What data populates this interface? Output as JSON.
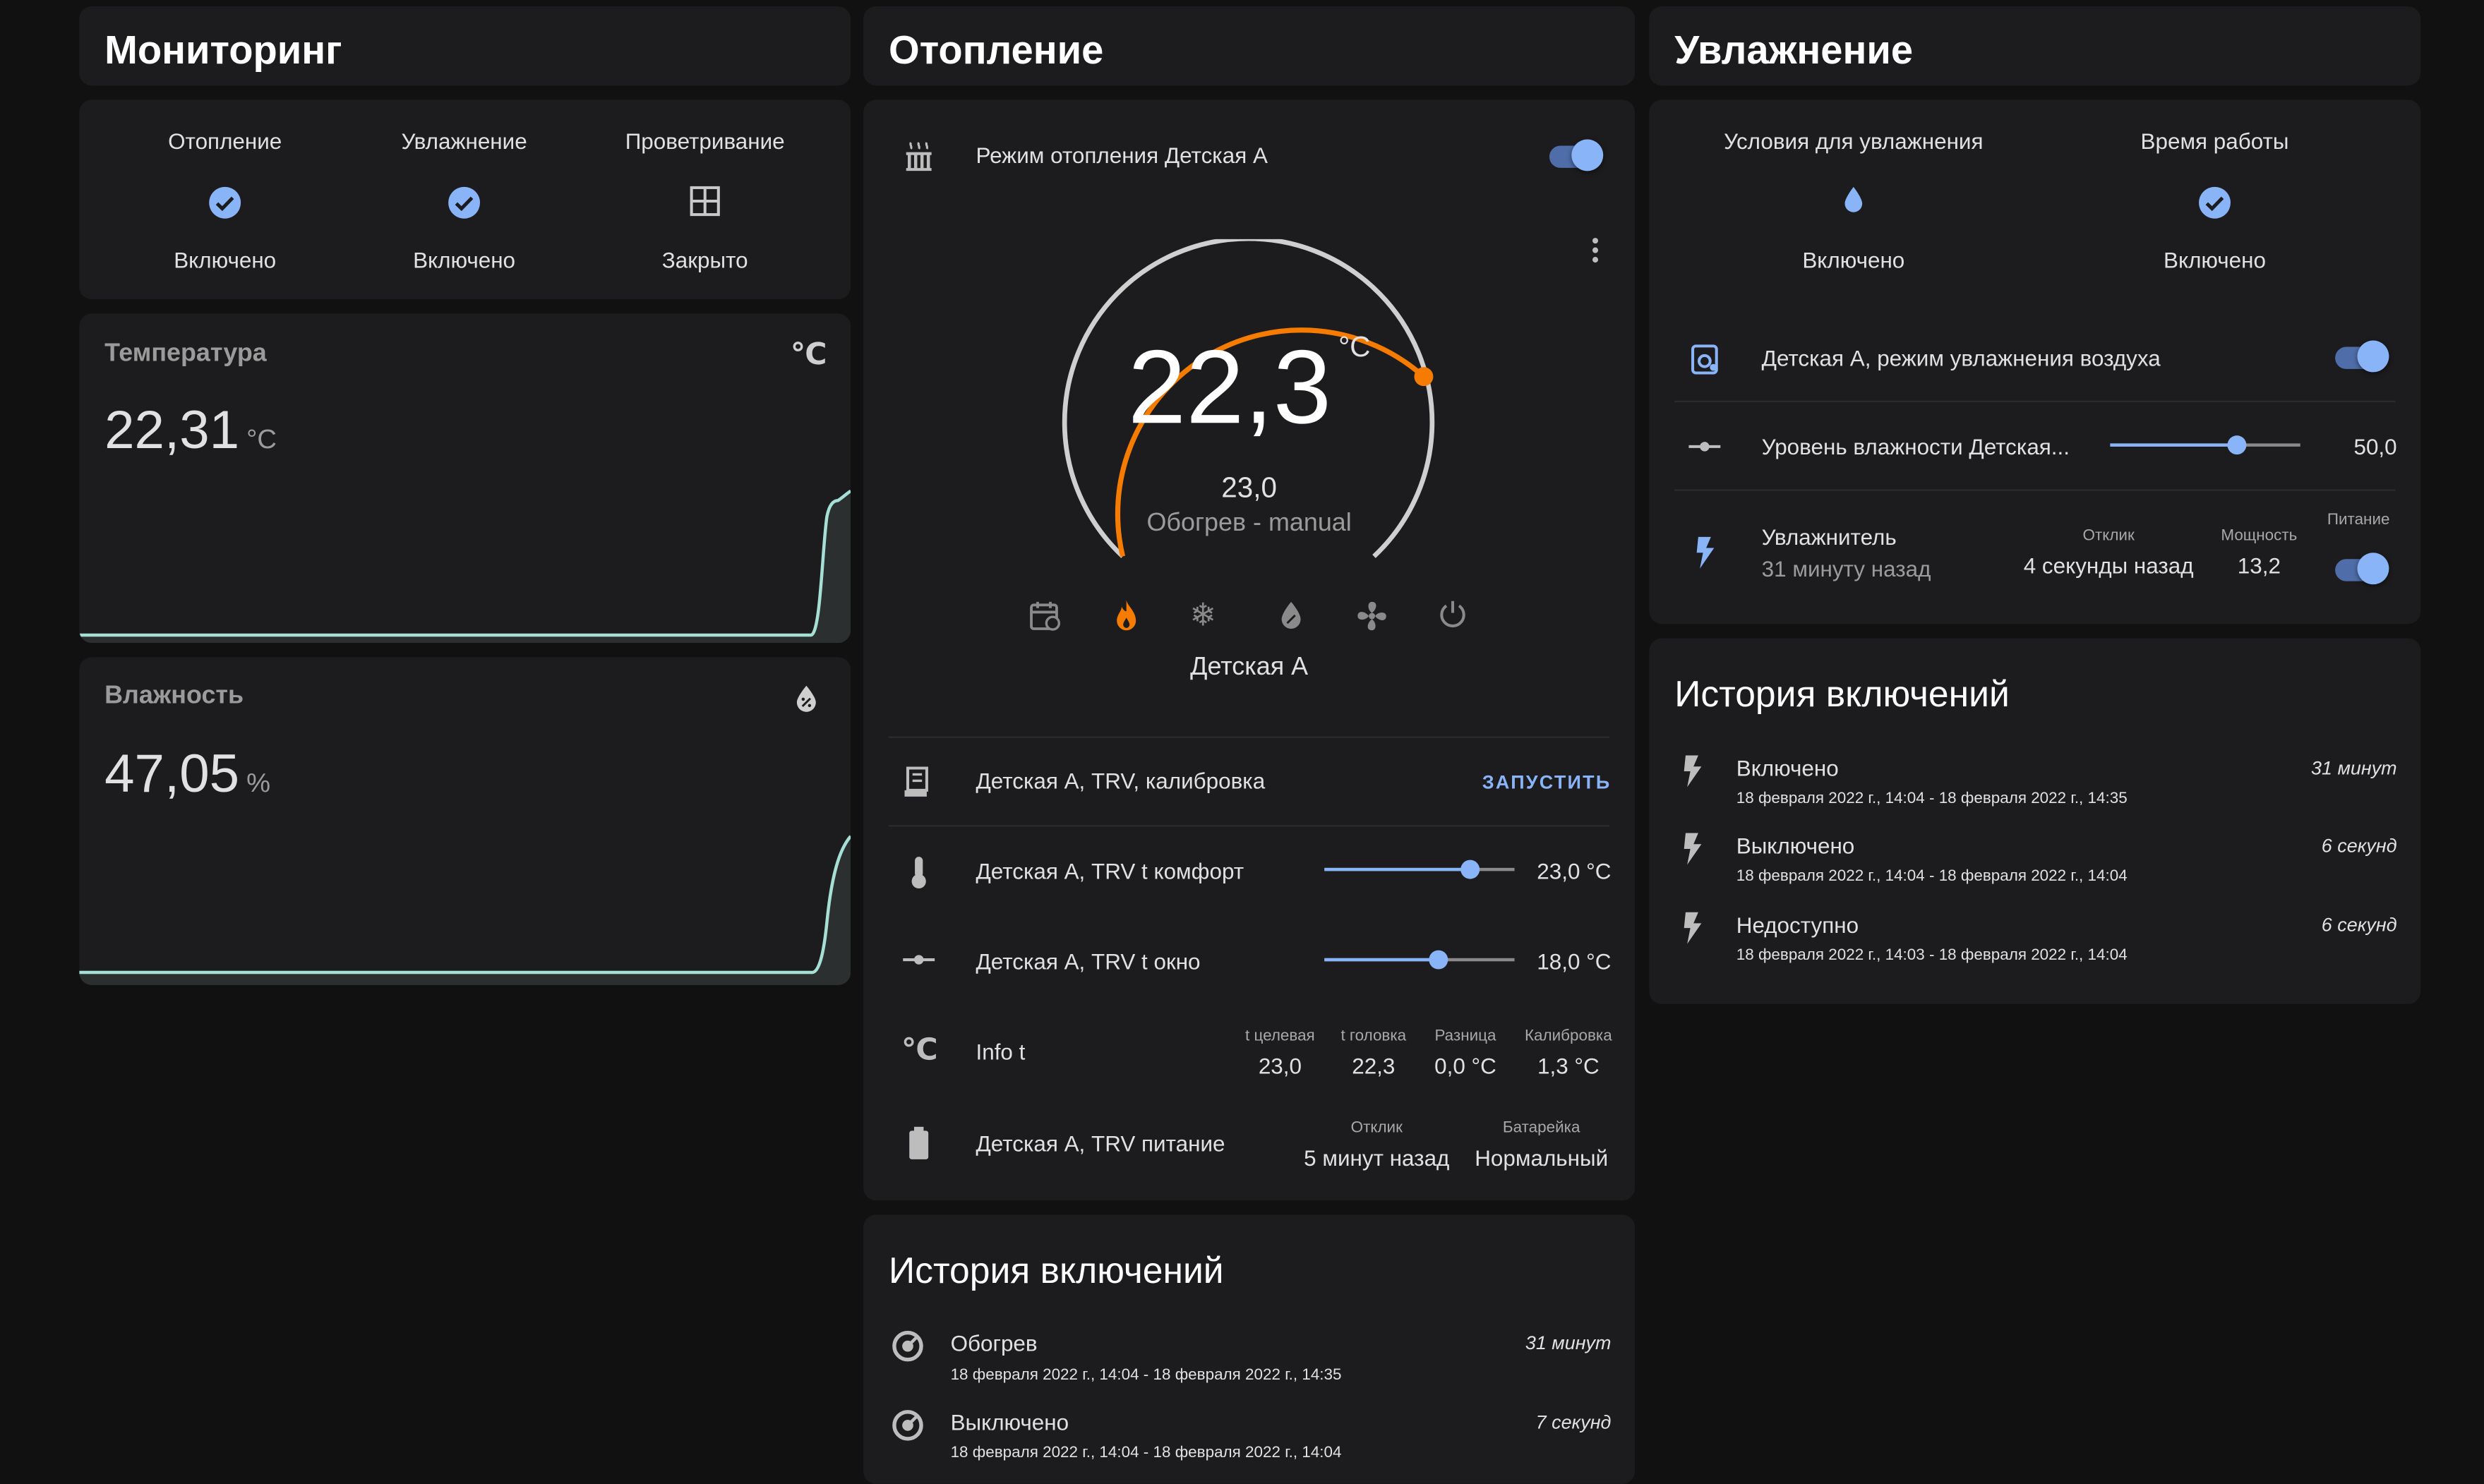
{
  "colors": {
    "background": "#111111",
    "card": "#1c1c1e",
    "accent": "#8ab4f8",
    "heat": "#f57c00"
  },
  "monitoring": {
    "title": "Мониторинг",
    "status": [
      {
        "label": "Отопление",
        "value": "Включено",
        "icon": "check-circle-icon"
      },
      {
        "label": "Увлажнение",
        "value": "Включено",
        "icon": "check-circle-icon"
      },
      {
        "label": "Проветривание",
        "value": "Закрыто",
        "icon": "window-icon"
      }
    ],
    "temperature": {
      "title": "Температура",
      "value": "22,31",
      "unit": "°C",
      "icon": "thermometer-celsius-icon"
    },
    "humidity": {
      "title": "Влажность",
      "value": "47,05",
      "unit": "%",
      "icon": "water-percent-icon"
    }
  },
  "heating": {
    "title": "Отопление",
    "mode_label": "Режим отопления Детская А",
    "mode_on": true,
    "thermostat": {
      "current": "22,3",
      "unit": "°C",
      "target": "23,0",
      "action": "Обогрев - manual",
      "name": "Детская А",
      "modes": [
        "schedule",
        "heat",
        "cool",
        "dry",
        "fan",
        "off"
      ],
      "active_mode": "heat"
    },
    "rows": {
      "calibration": {
        "label": "Детская А, TRV, калибровка",
        "button": "ЗАПУСТИТЬ"
      },
      "comfort": {
        "label": "Детская А, TRV t комфорт",
        "value": "23,0 °C",
        "level": 0.77
      },
      "window": {
        "label": "Детская А, TRV t окно",
        "value": "18,0 °C",
        "level": 0.6
      },
      "info": {
        "label": "Info t",
        "cols": [
          {
            "head": "t целевая",
            "value": "23,0"
          },
          {
            "head": "t головка",
            "value": "22,3"
          },
          {
            "head": "Разница",
            "value": "0,0 °C"
          },
          {
            "head": "Калибровка",
            "value": "1,3 °C"
          }
        ]
      },
      "power": {
        "label": "Детская А, TRV питание",
        "cols": [
          {
            "head": "Отклик",
            "value": "5 минут назад"
          },
          {
            "head": "Батарейка",
            "value": "Нормальный"
          }
        ]
      }
    },
    "history": {
      "title": "История включений",
      "items": [
        {
          "state": "Обогрев",
          "range": "18 февраля 2022 г., 14:04 - 18 февраля 2022 г., 14:35",
          "duration": "31 минут"
        },
        {
          "state": "Выключено",
          "range": "18 февраля 2022 г., 14:04 - 18 февраля 2022 г., 14:04",
          "duration": "7 секунд"
        }
      ]
    }
  },
  "humidification": {
    "title": "Увлажнение",
    "status": [
      {
        "label": "Условия для увлажнения",
        "value": "Включено",
        "icon": "water-drop-icon"
      },
      {
        "label": "Время работы",
        "value": "Включено",
        "icon": "check-circle-icon"
      }
    ],
    "mode_label": "Детская А, режим увлажнения воздуха",
    "mode_on": true,
    "level": {
      "label": "Уровень влажности Детская...",
      "value": "50,0",
      "level": 0.67
    },
    "device": {
      "name": "Увлажнитель",
      "last": "31 минуту назад",
      "cols": [
        {
          "head": "Отклик",
          "value": "4 секунды назад"
        },
        {
          "head": "Мощность",
          "value": "13,2"
        }
      ],
      "power_head": "Питание",
      "power_on": true
    },
    "history": {
      "title": "История включений",
      "items": [
        {
          "state": "Включено",
          "range": "18 февраля 2022 г., 14:04 - 18 февраля 2022 г., 14:35",
          "duration": "31 минут"
        },
        {
          "state": "Выключено",
          "range": "18 февраля 2022 г., 14:04 - 18 февраля 2022 г., 14:04",
          "duration": "6 секунд"
        },
        {
          "state": "Недоступно",
          "range": "18 февраля 2022 г., 14:03 - 18 февраля 2022 г., 14:04",
          "duration": "6 секунд"
        }
      ]
    }
  }
}
